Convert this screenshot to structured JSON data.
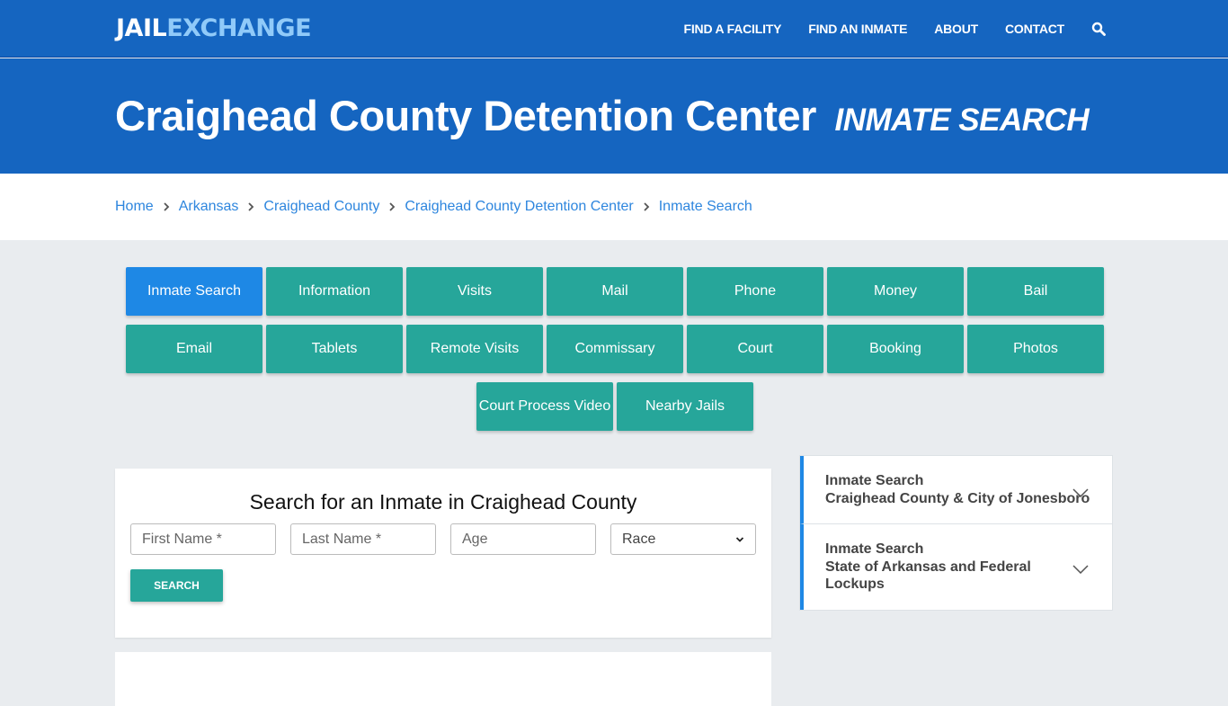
{
  "header": {
    "logo_part1": "JAIL",
    "logo_part2": "EXCHANGE",
    "nav": [
      "FIND A FACILITY",
      "FIND AN INMATE",
      "ABOUT",
      "CONTACT"
    ],
    "search_icon": "search-icon"
  },
  "hero": {
    "title": "Craighead County Detention Center",
    "subtitle": "INMATE SEARCH"
  },
  "breadcrumb": [
    "Home",
    "Arkansas",
    "Craighead County",
    "Craighead County Detention Center",
    "Inmate Search"
  ],
  "tabs": {
    "row1": [
      "Inmate Search",
      "Information",
      "Visits",
      "Mail",
      "Phone",
      "Money",
      "Bail"
    ],
    "row2": [
      "Email",
      "Tablets",
      "Remote Visits",
      "Commissary",
      "Court",
      "Booking",
      "Photos"
    ],
    "row3": [
      "Court Process Video",
      "Nearby Jails"
    ],
    "active": "Inmate Search"
  },
  "search_form": {
    "title": "Search for an Inmate in Craighead County",
    "first_name_placeholder": "First Name *",
    "last_name_placeholder": "Last Name *",
    "age_placeholder": "Age",
    "race_selected": "Race",
    "submit_label": "SEARCH"
  },
  "sidebar": {
    "items": [
      {
        "line1": "Inmate Search",
        "line2": "Craighead County & City of Jonesboro"
      },
      {
        "line1": "Inmate Search",
        "line2": "State of Arkansas and Federal Lockups"
      }
    ]
  },
  "colors": {
    "brand_blue": "#1565c0",
    "logo_accent": "#90caf9",
    "tab_teal": "#26a69a",
    "tab_active": "#1e88e5",
    "link": "#2e86de"
  }
}
